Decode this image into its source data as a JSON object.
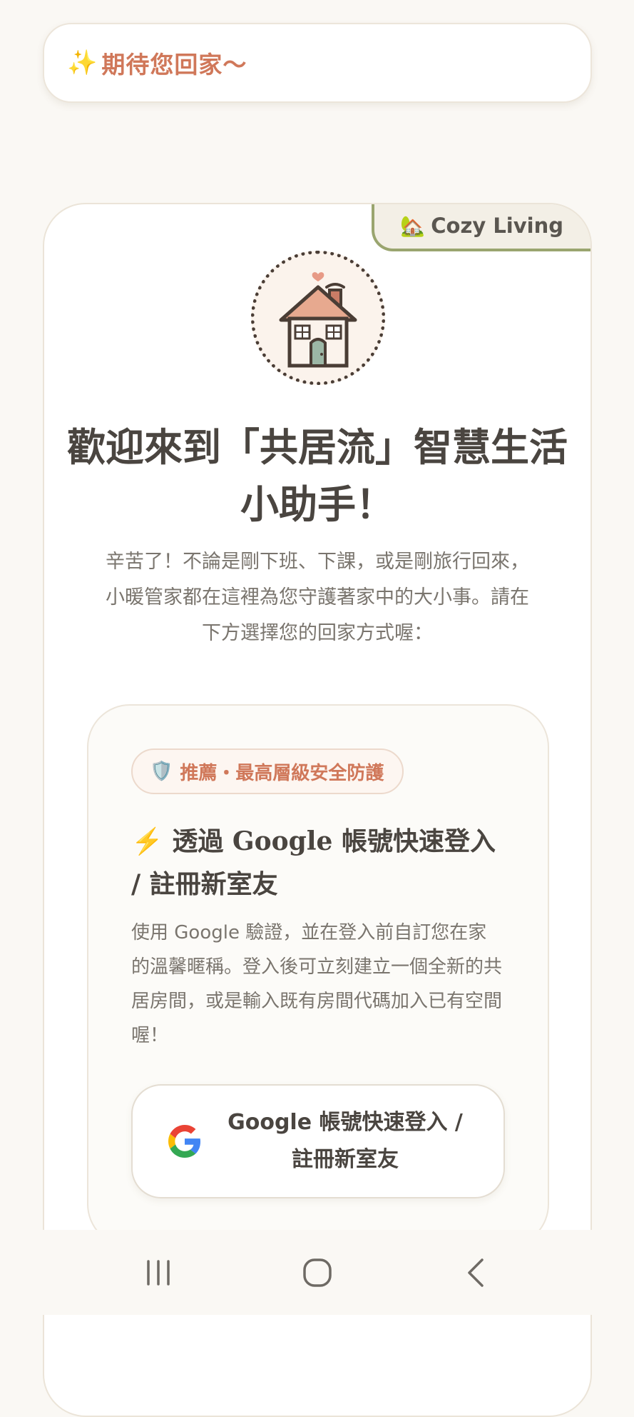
{
  "banner": {
    "icon": "sparkles-icon",
    "text": "期待您回家～"
  },
  "card": {
    "tag": {
      "icon": "house-icon",
      "label": "Cozy Living"
    },
    "logo": "house-logo-icon",
    "title": "歡迎來到「共居流」智慧生活小助手！",
    "description": "辛苦了！不論是剛下班、下課，或是剛旅行回來，小暖管家都在這裡為您守護著家中的大小事。請在下方選擇您的回家方式喔："
  },
  "login": {
    "badge": {
      "icon": "shield-icon",
      "text": "推薦・最高層級安全防護"
    },
    "title": "透過 Google 帳號快速登入 / 註冊新室友",
    "title_icon": "lightning-icon",
    "description": "使用 Google 驗證，並在登入前自訂您在家的溫馨暱稱。登入後可立刻建立一個全新的共居房間，或是輸入既有房間代碼加入已有空間喔！",
    "button": {
      "icon": "google-icon",
      "label": "Google 帳號快速登入 / 註冊新室友"
    }
  },
  "navigation": {
    "recents": "recent-apps-icon",
    "home": "home-icon",
    "back": "back-icon"
  },
  "colors": {
    "accent": "#d0785a",
    "olive": "#9aa56f",
    "background": "#faf8f4"
  }
}
